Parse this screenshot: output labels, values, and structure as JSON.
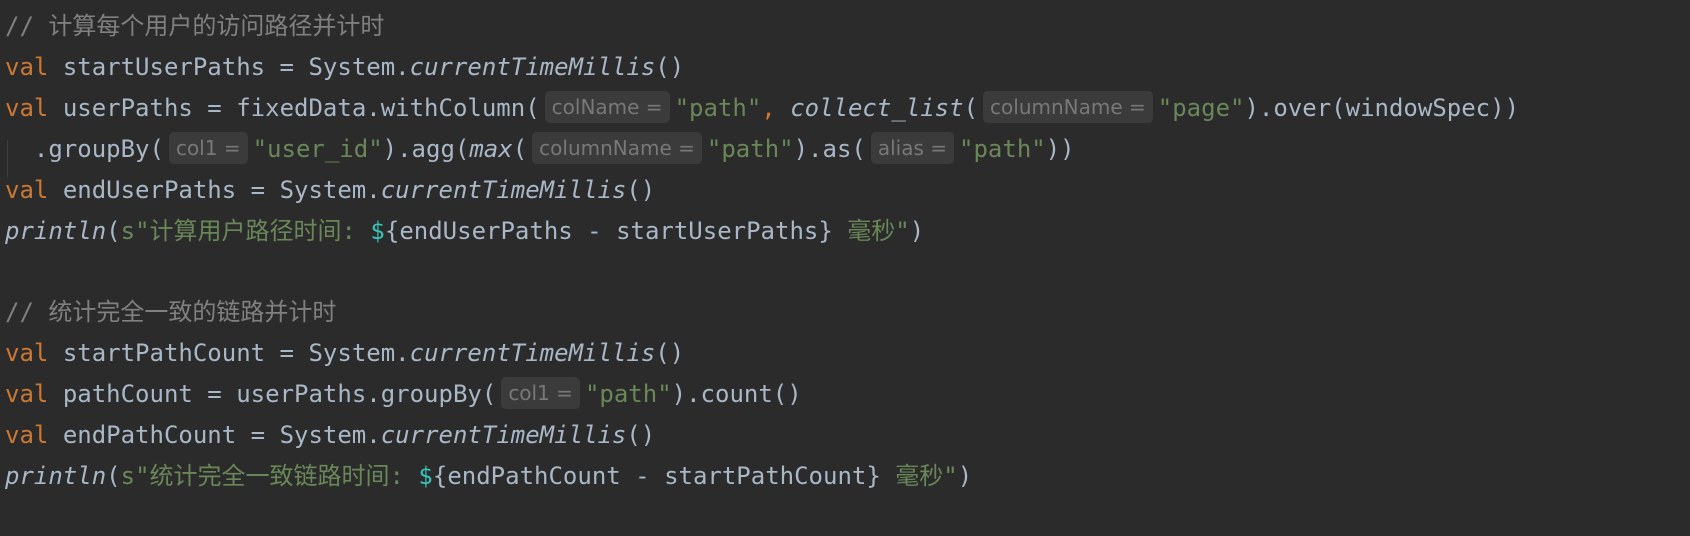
{
  "colors": {
    "background": "#2b2b2b",
    "keyword": "#cc7832",
    "string": "#6a8759",
    "identifier": "#a9b7c6",
    "comment": "#808080",
    "interpolation": "#39c5bb",
    "hint_text": "#787878",
    "hint_background": "#3b3b3b"
  },
  "tokens": {
    "kw_val": "val",
    "eq": " = ",
    "system": "System.",
    "current_time_millis": "currentTimeMillis",
    "empty_parens": "()",
    "println": "println",
    "s_prefix": "s",
    "dollar": "$"
  },
  "lines": {
    "l1": {
      "comment": "// 计算每个用户的访问路径并计时"
    },
    "l2": {
      "name": "startUserPaths"
    },
    "l3": {
      "name": "userPaths",
      "call1": "fixedData.withColumn(",
      "hint1": "colName =",
      "arg1": "\"path\"",
      "comma": ", ",
      "fn2": "collect_list",
      "paren_open": "(",
      "hint2": "columnName =",
      "arg2": "\"page\"",
      "tail": ").over(windowSpec))"
    },
    "l4": {
      "call1": "  .groupBy(",
      "hint1": "col1 =",
      "arg1": "\"user_id\"",
      "call2": ").agg(",
      "fn": "max",
      "paren_open": "(",
      "hint2": "columnName =",
      "arg2": "\"path\"",
      "call3": ").as(",
      "hint3": "alias =",
      "arg3": "\"path\"",
      "tail": "))"
    },
    "l5": {
      "name": "endUserPaths"
    },
    "l6": {
      "str_open": "\"计算用户路径时间: ",
      "expr": "{endUserPaths - startUserPaths}",
      "str_close": " 毫秒\"",
      "tail": ")"
    },
    "l8": {
      "comment": "// 统计完全一致的链路并计时"
    },
    "l9": {
      "name": "startPathCount"
    },
    "l10": {
      "name": "pathCount",
      "call1": "userPaths.groupBy(",
      "hint1": "col1 =",
      "arg1": "\"path\"",
      "tail": ").count()"
    },
    "l11": {
      "name": "endPathCount"
    },
    "l12": {
      "str_open": "\"统计完全一致链路时间: ",
      "expr": "{endPathCount - startPathCount}",
      "str_close": " 毫秒\"",
      "tail": ")"
    }
  }
}
